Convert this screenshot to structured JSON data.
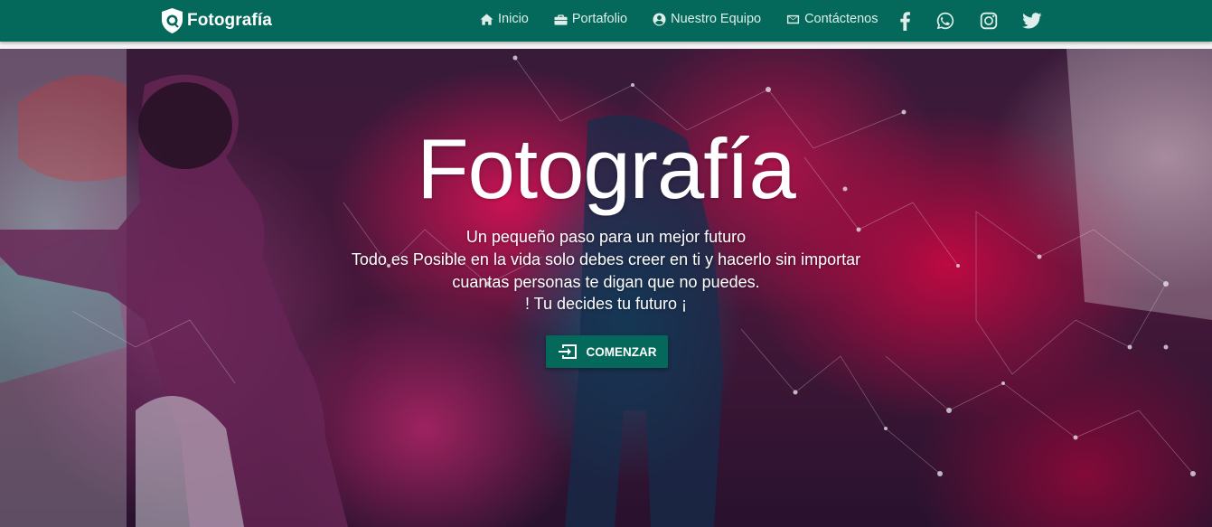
{
  "brand": {
    "name": "Fotografía",
    "logo_icon": "shield-camera-icon"
  },
  "nav": {
    "links": [
      {
        "label": "Inicio",
        "icon": "home-icon"
      },
      {
        "label": "Portafolio",
        "icon": "briefcase-icon"
      },
      {
        "label": "Nuestro Equipo",
        "icon": "user-circle-icon"
      },
      {
        "label": "Contáctenos",
        "icon": "envelope-icon"
      }
    ],
    "social": [
      "facebook-icon",
      "whatsapp-icon",
      "instagram-icon",
      "twitter-icon"
    ]
  },
  "hero": {
    "title": "Fotografía",
    "lines": [
      "Un pequeño paso para un mejor futuro",
      "Todo es Posible en la vida solo debes creer en ti y hacerlo sin importar",
      "cuantas personas te digan que no puedes.",
      "! Tu decides tu futuro ¡"
    ],
    "cta_label": "COMENZAR",
    "cta_icon": "sign-in-icon"
  },
  "colors": {
    "primary": "#04685a",
    "nav_text": "#dfeeea",
    "hero_text": "#ffffff"
  }
}
